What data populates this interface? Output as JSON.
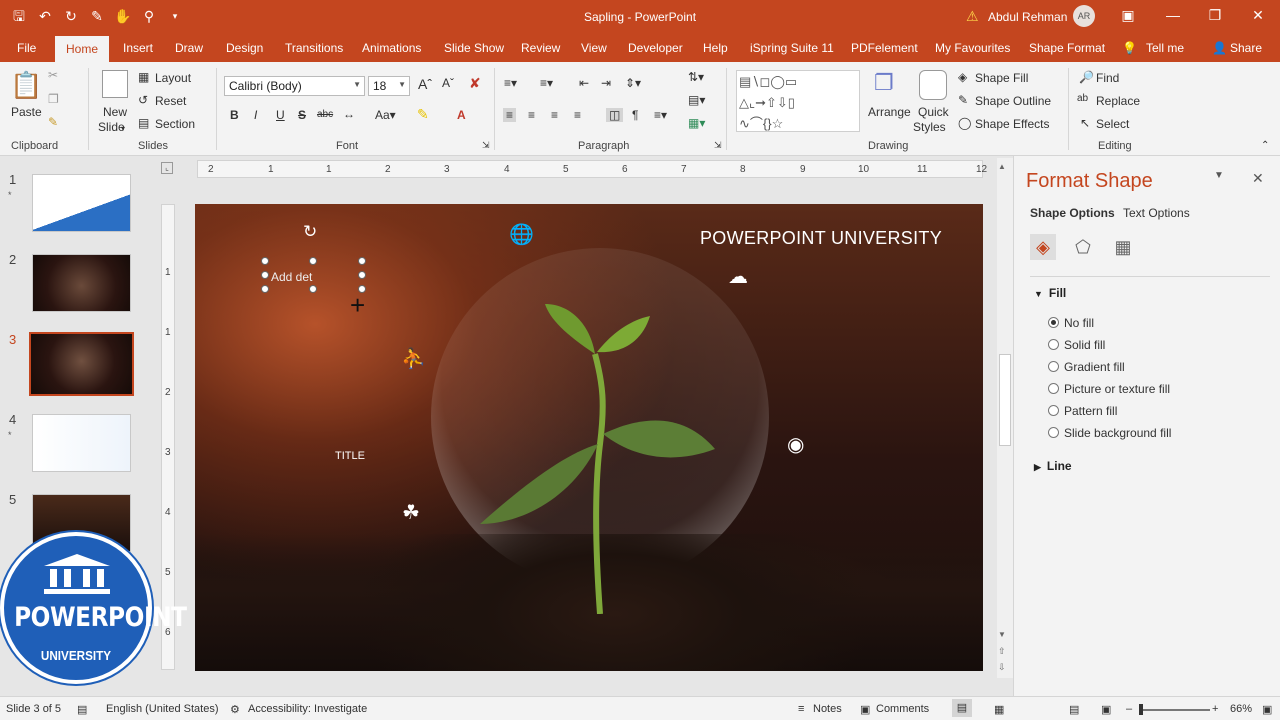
{
  "window": {
    "title": "Sapling  -  PowerPoint",
    "user_name": "Abdul Rehman",
    "user_initials": "AR",
    "accent": "#c4461f"
  },
  "tabs": [
    "File",
    "Home",
    "Insert",
    "Draw",
    "Design",
    "Transitions",
    "Animations",
    "Slide Show",
    "Review",
    "View",
    "Developer",
    "Help",
    "iSpring Suite 11",
    "PDFelement",
    "My Favourites",
    "Shape Format",
    "Tell me",
    "Share"
  ],
  "ribbon": {
    "clipboard": {
      "paste": "Paste",
      "label": "Clipboard"
    },
    "slides": {
      "new_slide_1": "New",
      "new_slide_2": "Slide",
      "layout": "Layout",
      "reset": "Reset",
      "section": "Section",
      "label": "Slides"
    },
    "font": {
      "family": "Calibri (Body)",
      "size": "18",
      "label": "Font"
    },
    "paragraph": {
      "label": "Paragraph"
    },
    "drawing": {
      "arrange": "Arrange",
      "quick_styles_1": "Quick",
      "quick_styles_2": "Styles",
      "shape_fill": "Shape Fill",
      "shape_outline": "Shape Outline",
      "shape_effects": "Shape Effects",
      "label": "Drawing"
    },
    "editing": {
      "find": "Find",
      "replace": "Replace",
      "select": "Select",
      "label": "Editing"
    }
  },
  "ruler": {
    "h": [
      "2",
      "1",
      "1",
      "2",
      "3",
      "4",
      "5",
      "6",
      "7",
      "8",
      "9",
      "10",
      "11",
      "12"
    ],
    "v": [
      "1",
      "1",
      "2",
      "3",
      "4",
      "5",
      "6"
    ]
  },
  "slides": [
    {
      "number": "1",
      "star": "*"
    },
    {
      "number": "2",
      "star": ""
    },
    {
      "number": "3",
      "star": "",
      "selected": true
    },
    {
      "number": "4",
      "star": "*"
    },
    {
      "number": "5",
      "star": ""
    }
  ],
  "slide": {
    "heading": "POWERPOINT UNIVERSITY",
    "textbox": "Add det",
    "title": "TITLE",
    "icons": [
      "globe-icon",
      "cloud-network-icon",
      "person-icon",
      "brain-head-icon",
      "hand-plant-icon"
    ]
  },
  "format_pane": {
    "title": "Format Shape",
    "shape_options": "Shape Options",
    "text_options": "Text Options",
    "fill": "Fill",
    "line": "Line",
    "fill_options": [
      "No fill",
      "Solid fill",
      "Gradient fill",
      "Picture or texture fill",
      "Pattern fill",
      "Slide background fill"
    ],
    "selected_fill": "No fill"
  },
  "status": {
    "slide": "Slide 3 of 5",
    "language": "English (United States)",
    "accessibility": "Accessibility: Investigate",
    "notes": "Notes",
    "comments": "Comments",
    "zoom": "66%"
  },
  "logo": {
    "main": "POWERPOINT",
    "sub": "UNIVERSITY"
  }
}
